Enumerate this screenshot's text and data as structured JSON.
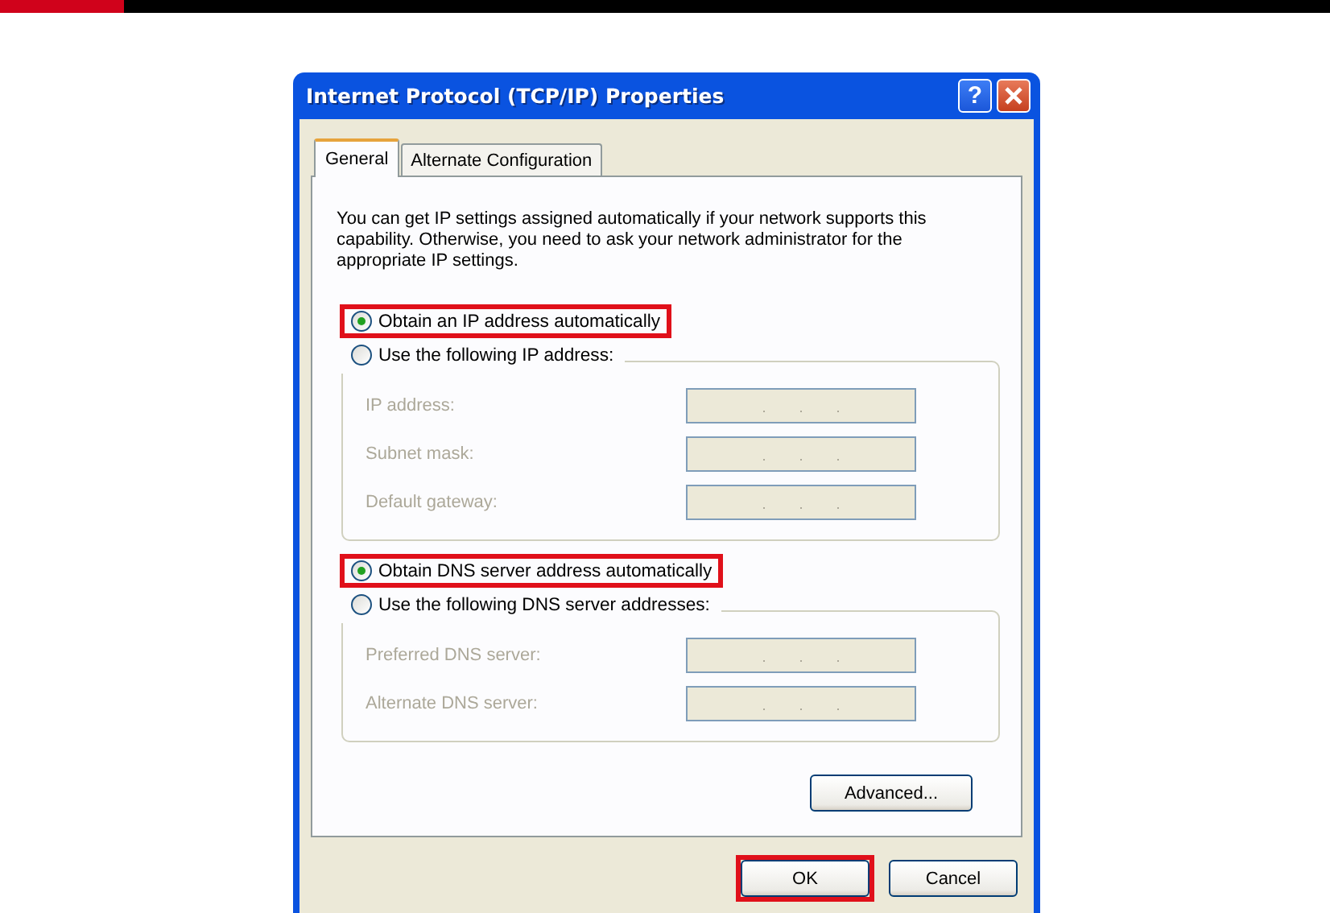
{
  "window": {
    "title": "Internet Protocol (TCP/IP) Properties",
    "help_label": "?"
  },
  "tabs": [
    {
      "label": "General",
      "selected": true
    },
    {
      "label": "Alternate Configuration",
      "selected": false
    }
  ],
  "description": "You can get IP settings assigned automatically if your network supports this capability. Otherwise, you need to ask your network administrator for the appropriate IP settings.",
  "sections": [
    {
      "auto": {
        "label": "Obtain an IP address automatically",
        "selected": true,
        "highlighted": true
      },
      "manual": {
        "label": "Use the following IP address:",
        "selected": false,
        "highlighted": false
      },
      "fields": [
        {
          "label": "IP address:",
          "disabled": true
        },
        {
          "label": "Subnet mask:",
          "disabled": true
        },
        {
          "label": "Default gateway:",
          "disabled": true
        }
      ]
    },
    {
      "auto": {
        "label": "Obtain DNS server address automatically",
        "selected": true,
        "highlighted": true
      },
      "manual": {
        "label": "Use the following DNS server addresses:",
        "selected": false,
        "highlighted": false
      },
      "fields": [
        {
          "label": "Preferred DNS server:",
          "disabled": true
        },
        {
          "label": "Alternate DNS server:",
          "disabled": true
        }
      ]
    }
  ],
  "advanced_button": "Advanced...",
  "footer_buttons": [
    {
      "label": "OK",
      "highlighted": true
    },
    {
      "label": "Cancel",
      "highlighted": false
    }
  ]
}
